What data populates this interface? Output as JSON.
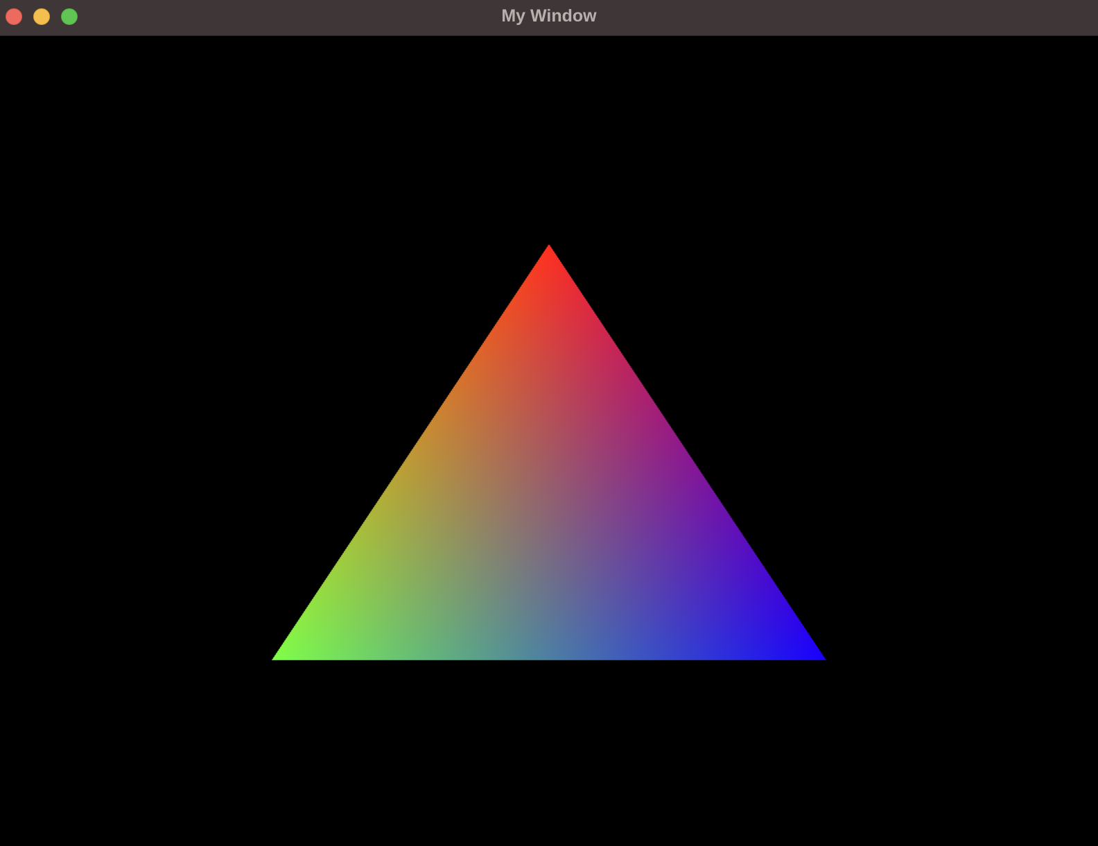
{
  "window": {
    "title": "My Window",
    "controls": {
      "close_color": "#ed6a5e",
      "minimize_color": "#f5bf4f",
      "zoom_color": "#61c554"
    }
  },
  "scene": {
    "background": "#000000",
    "shape": "triangle",
    "vertex_colors": [
      "#ff3020",
      "#80ff48",
      "#1800ff"
    ]
  }
}
